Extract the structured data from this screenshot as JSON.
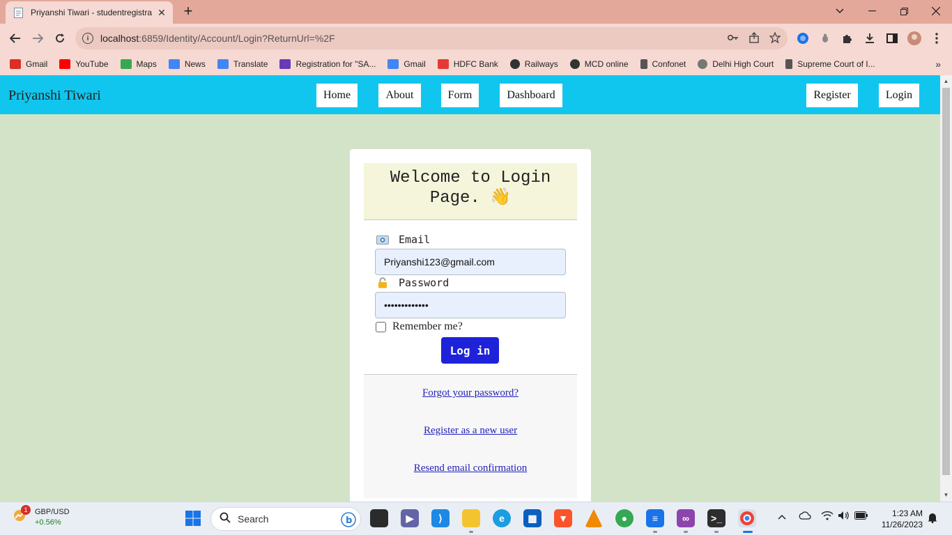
{
  "browser": {
    "tab_title": "Priyanshi Tiwari - studentregistra",
    "tab_close": "✕",
    "new_tab": "+",
    "url_main": "localhost",
    "url_rest": ":6859/Identity/Account/Login?ReturnUrl=%2F",
    "bookmarks": [
      {
        "label": "Gmail",
        "color": "#d93025"
      },
      {
        "label": "YouTube",
        "color": "#ff0000"
      },
      {
        "label": "Maps",
        "color": "#34a853"
      },
      {
        "label": "News",
        "color": "#4285f4"
      },
      {
        "label": "Translate",
        "color": "#4285f4"
      },
      {
        "label": "Registration for \"SA...",
        "color": "#673ab7"
      },
      {
        "label": "Gmail",
        "color": "#4285f4"
      },
      {
        "label": "HDFC Bank",
        "color": "#e53935"
      },
      {
        "label": "Railways",
        "color": "#333333"
      },
      {
        "label": "MCD online",
        "color": "#333333"
      },
      {
        "label": "Confonet",
        "color": "#555555"
      },
      {
        "label": "Delhi High Court",
        "color": "#777777"
      },
      {
        "label": "Supreme Court of I...",
        "color": "#555555"
      }
    ]
  },
  "page": {
    "brand": "Priyanshi Tiwari",
    "nav": {
      "home": "Home",
      "about": "About",
      "form": "Form",
      "dashboard": "Dashboard",
      "register": "Register",
      "login": "Login"
    },
    "card": {
      "heading_line1": "Welcome to Login",
      "heading_line2": "Page. 👋",
      "email_label": "Email",
      "email_value": "Priyanshi123@gmail.com",
      "password_label": "Password",
      "password_value": "•••••••••••••",
      "remember_label": "Remember me?",
      "login_button": "Log in",
      "forgot_link": "Forgot your password?",
      "register_link": "Register as a new user",
      "resend_link": "Resend email confirmation"
    }
  },
  "taskbar": {
    "stock_badge": "1",
    "stock_name": "GBP/USD",
    "stock_change": "+0.56%",
    "search_placeholder": "Search",
    "time": "1:23 AM",
    "date": "11/26/2023"
  },
  "colors": {
    "navbar": "#11c6ee",
    "page_bg": "#d3e3c7",
    "login_button": "#1e22d9",
    "header_bg": "#f4f5da"
  }
}
